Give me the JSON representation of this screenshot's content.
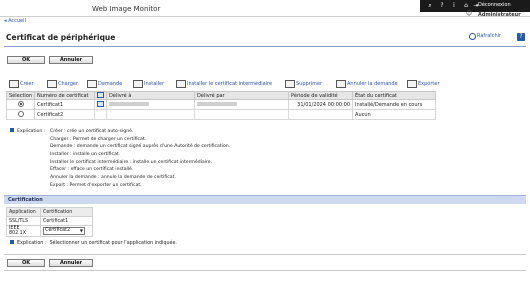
{
  "header": {
    "app_title": "Web Image Monitor",
    "logout_label": "Déconnexion",
    "user_label": "Administrateur",
    "back_link": "◂ Accueil"
  },
  "page": {
    "title": "Certificat de périphérique",
    "refresh_label": "Rafraîchir"
  },
  "buttons": {
    "ok": "OK",
    "cancel": "Annuler"
  },
  "toolbar": [
    {
      "label": "Créer",
      "icon": "create-icon"
    },
    {
      "label": "Charger",
      "icon": "upload-icon"
    },
    {
      "label": "Demande",
      "icon": "request-icon"
    },
    {
      "label": "Installer",
      "icon": "install-icon"
    },
    {
      "label": "Installer le certificat intermédiaire",
      "icon": "install-intermediate-icon"
    },
    {
      "label": "Supprimer",
      "icon": "delete-icon"
    },
    {
      "label": "Annuler la demande",
      "icon": "cancel-request-icon"
    },
    {
      "label": "Exporter",
      "icon": "export-icon"
    }
  ],
  "cert_table": {
    "headers": [
      "Sélection",
      "Numéro de certificat",
      "",
      "Délivré à",
      "Délivré par",
      "Période de validité",
      "État du certificat"
    ],
    "rows": [
      {
        "selected": true,
        "number": "Certificat1",
        "has_icon": true,
        "validity": "31/01/2024 00:00:00",
        "status": "Installé/Demande en cours"
      },
      {
        "selected": false,
        "number": "Certificat2",
        "has_icon": false,
        "validity": "",
        "status": "Aucun"
      }
    ]
  },
  "explanation": {
    "label": "Explication :",
    "lines": [
      "Créer : crée un certificat auto-signé.",
      "Charger : Permet de charger un certificat.",
      "Demande : demande un certificat signé auprès d'une Autorité de certification.",
      "Installer : installe un certificat.",
      "Installer le certificat intermédiaire : installe un certificat intermédiaire.",
      "Effacer : efface un certificat installé.",
      "Annuler la demande : annule la demande de certificat.",
      "Export : Permet d'exporter un certificat."
    ]
  },
  "certification": {
    "section_title": "Certification",
    "headers": [
      "Application",
      "Certification"
    ],
    "rows": [
      {
        "application": "SSL/TLS",
        "certification": "Certificat1"
      },
      {
        "application": "IEEE 802.1X",
        "certification": "Certificat2"
      }
    ]
  },
  "explanation2": {
    "label": "Explication :",
    "text": "Sélectionner un certificat pour l'application indiquée."
  }
}
